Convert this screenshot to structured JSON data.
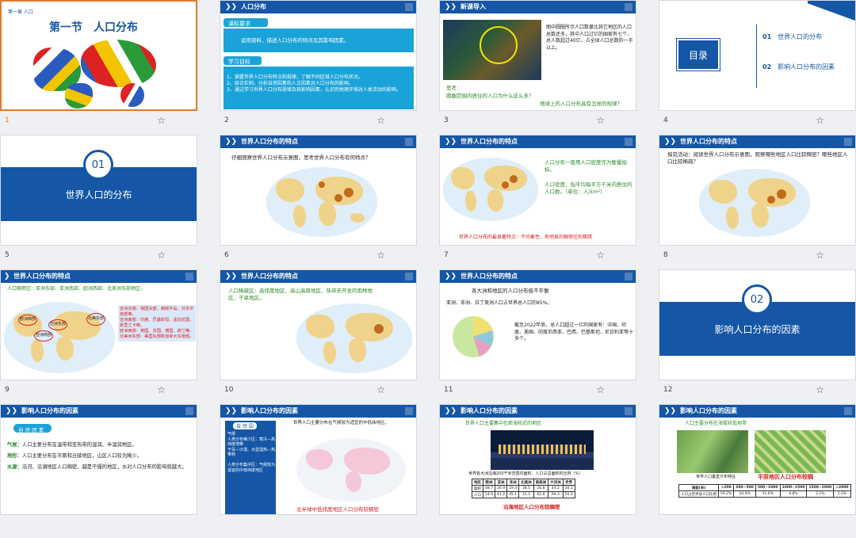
{
  "slides": [
    {
      "num": "1",
      "header": "第一章 人口",
      "title": "第一节　人口分布"
    },
    {
      "num": "2",
      "header": "人口分布",
      "sec1": "课标要求",
      "sec1_body": "运用资料，描述人口分布的特点及其影响因素。",
      "sec2": "学习目标",
      "sec2_body": "1、掌握世界人口分布特点和规律，了解不同区域人口分布状况。\n2、结合实例，分析自然因素和人文因素对人口分布的影响。\n3、通过学习世界人口分布规律及其影响因素，认识到地理环境对人类活动的影响。"
    },
    {
      "num": "3",
      "header": "新课导入",
      "body": "图中圆圈所示人口数量比其它地区的人口总数还多，其中人口过亿的国家有七个，总人数超过40亿，占全球人口总数的一半以上。",
      "q_label": "思考：",
      "q": "圆圈范围内居住的人口为什么这么多？",
      "q2": "地球上的人口分布具有怎样的规律？"
    },
    {
      "num": "4",
      "title": "目录",
      "item1_num": "01",
      "item1": "世界人口的分布",
      "item2_num": "02",
      "item2": "影响人口分布的因素"
    },
    {
      "num": "5",
      "badge": "01",
      "title": "世界人口的分布"
    },
    {
      "num": "6",
      "header": "世界人口分布的特点",
      "body": "仔细观察世界人口分布示意图，思考世界人口分布有何特点？"
    },
    {
      "num": "7",
      "header": "世界人口分布的特点",
      "body1": "人口分布一般用人口密度作为衡量指标。",
      "body2": "人口密度，指平均每平方千米内居住的人口数。（单位：人/km²）",
      "bottom": "世界人口分布的最显著特点：不均衡性，有明显的稠密区和稀疏"
    },
    {
      "num": "8",
      "header": "世界人口分布的特点",
      "body": "探究活动：阅读世界人口分布示意图，观察哪些地区人口比较稠密？哪些地区人口比较稀疏？"
    },
    {
      "num": "9",
      "header": "世界人口分布的特点",
      "body": "人口稠密区：亚洲东部、亚洲南部、欧洲西部、北美洲东部地区。",
      "box": "亚洲东部：我国东部、朝鲜半岛、日本中南部等。\n亚洲南部：印度、巴基斯坦、孟加拉国、斯里兰卡等。\n欧洲西部：英国、法国、德国、荷兰等。\n北美洲东部：美国东部和加拿大东南部。",
      "lab1": "欧洲西部",
      "lab2": "亚洲东部",
      "lab3": "亚洲南部",
      "lab4": "北美东部"
    },
    {
      "num": "10",
      "header": "世界人口分布的特点",
      "body": "人口稀疏区：高纬度地区、高山高原地区、热带未开发的雨林地区、干旱地区。"
    },
    {
      "num": "11",
      "header": "世界人口分布的特点",
      "sub": "各大洲和地区的人口分布极不平衡",
      "sub2": "亚洲、非洲、拉丁美洲人口占世界总人口的85%。",
      "body": "截至2022年底，总人口超过一亿的国家有：中国、印度、美国、印度尼西亚、巴西、巴基斯坦、尼日利亚等十多个。"
    },
    {
      "num": "12",
      "badge": "02",
      "title": "影响人口分布的因素"
    },
    {
      "num": "",
      "header": "影响人口分布的因素",
      "tag": "自 然 因 素",
      "l1_k": "气候：",
      "l1": "人口主要分布在温带和亚热带的湿润、半湿润地区。",
      "l2_k": "地形：",
      "l2": "人口主要分布在平原和丘陵地区，山区人口较为稀少。",
      "l3_k": "水源：",
      "l3": "沿河、沿湖地区人口稠密，越是干燥的地区，水对人口分布的影响就越大。"
    },
    {
      "num": "",
      "header": "影响人口分布的因素",
      "tag": "自 然 因",
      "side": "气候\n人类分布稀少区：寒冷—高纬度地带\n干旱—沙漠、大型湿热—热带林\n\n人类分布集中区：气候较为适宜的中低纬度地区",
      "top": "世界人口主要分布在气候较为适宜的中低纬地区。",
      "bottom": "北半球中低纬度地区人口分布较稠密"
    },
    {
      "num": "",
      "header": "影响人口分布的因素",
      "top": "世界人口主要集中在距海较近的地区",
      "cap": "世界各大洲沿海200千米范围内面积、人口占总面积的比例（%）",
      "rows": [
        [
          "地区",
          "欧洲",
          "亚洲",
          "非洲",
          "北美洲",
          "南美洲",
          "大洋洲",
          "世界"
        ],
        [
          "面积",
          "48.7",
          "26.9",
          "19.4",
          "38.5",
          "26.8",
          "44.2",
          "30.1"
        ],
        [
          "人口",
          "54.9",
          "41.2",
          "45.1",
          "31.3",
          "62.8",
          "94.3",
          "50.3"
        ]
      ],
      "bottom": "沿海地区人口分布较稠密"
    },
    {
      "num": "",
      "header": "影响人口分布的因素",
      "top": "人口主要分布在海拔较低地带",
      "cap": "世界人口垂直分布特征",
      "red": "平原地区人口分布较稠",
      "rows": [
        [
          "海拔(米)",
          "<200",
          "200~500",
          "500~1000",
          "1000~1500",
          "1500~2000",
          ">2000"
        ],
        [
          "人口占世界总人口比例",
          "56.2%",
          "24.0%",
          "11.6%",
          "4.8%",
          "2.1%",
          "1.3%"
        ]
      ]
    }
  ],
  "colors": {
    "accent": "#1556a6",
    "selected": "#e07a2e",
    "green": "#2a8a2a",
    "red": "#d62020",
    "cyan": "#1aa3d8"
  }
}
